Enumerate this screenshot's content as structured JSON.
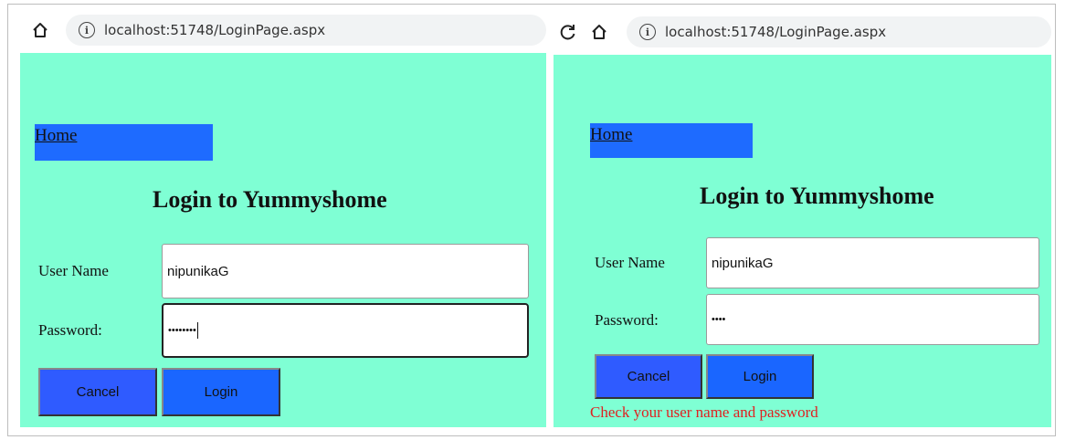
{
  "browser": {
    "url": "localhost:51748/LoginPage.aspx",
    "info_symbol": "i"
  },
  "page": {
    "home_link": "Home",
    "title": "Login to Yummyshome",
    "username_label": "User Name",
    "password_label": "Password:",
    "cancel_label": "Cancel",
    "login_label": "Login"
  },
  "left_panel": {
    "username_value": "nipunikaG",
    "password_masked": "••••••••"
  },
  "right_panel": {
    "username_value": "nipunikaG",
    "password_masked": "••••",
    "error_message": "Check your user name and password"
  },
  "colors": {
    "page_background": "#7fffd4",
    "home_bar": "#1e6bff",
    "button": "#2f5bff",
    "error_text": "#e02020"
  },
  "icons": {
    "home": "home-icon",
    "reload": "reload-icon",
    "info": "info-icon"
  }
}
